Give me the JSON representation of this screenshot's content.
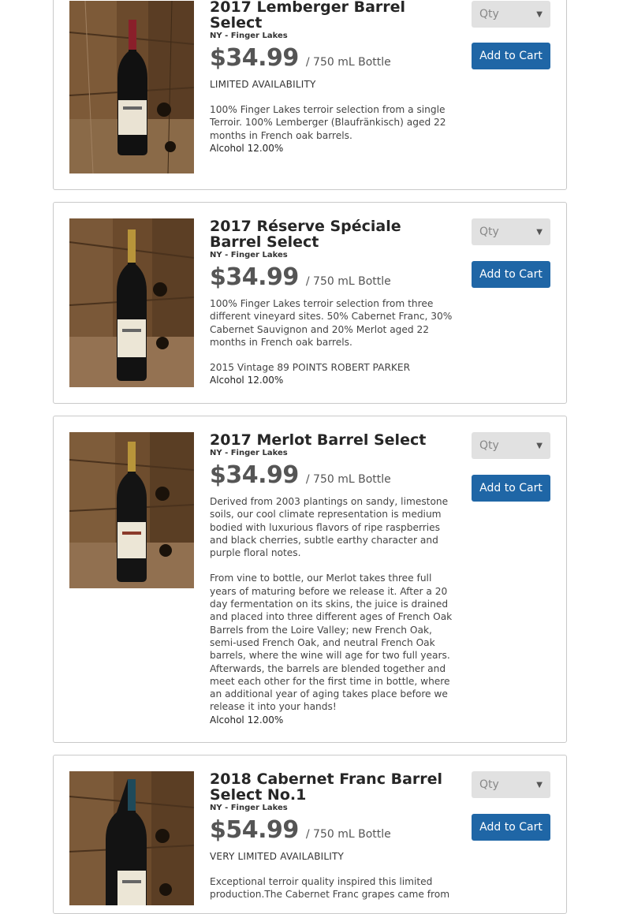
{
  "colors": {
    "button_bg": "#1f66a6",
    "select_bg": "#e1e1e1",
    "price": "#555555",
    "card_border": "#c9c9c9"
  },
  "products": [
    {
      "title": "2017 Lemberger Barrel Select",
      "region": "NY - Finger Lakes",
      "price": "$34.99",
      "unit": "/ 750 mL Bottle",
      "availability": "LIMITED AVAILABILITY",
      "description": [
        "100% Finger Lakes terroir selection from a single Terroir. 100% Lemberger (Blaufränkisch) aged 22 months in French oak barrels."
      ],
      "alcohol": "Alcohol 12.00%",
      "qty_placeholder": "Qty",
      "cart_label": "Add to Cart",
      "capsule_color": "#8a1f2a"
    },
    {
      "title": "2017 Réserve Spéciale Barrel Select",
      "region": "NY - Finger Lakes",
      "price": "$34.99",
      "unit": "/ 750 mL Bottle",
      "availability": "",
      "description": [
        "100% Finger Lakes terroir selection from three different vineyard sites. 50% Cabernet Franc, 30% Cabernet Sauvignon and 20% Merlot aged 22 months in French oak barrels.",
        "2015 Vintage 89 POINTS ROBERT PARKER"
      ],
      "alcohol": "Alcohol 12.00%",
      "qty_placeholder": "Qty",
      "cart_label": "Add to Cart",
      "capsule_color": "#b8953a"
    },
    {
      "title": "2017 Merlot Barrel Select",
      "region": "NY - Finger Lakes",
      "price": "$34.99",
      "unit": "/ 750 mL Bottle",
      "availability": "",
      "description": [
        "Derived from 2003 plantings on sandy, limestone soils, our cool climate representation is medium bodied with luxurious flavors of ripe raspberries and black cherries, subtle earthy character and purple floral notes.",
        "From vine to bottle, our Merlot takes three full years of maturing before we release it. After a 20 day fermentation on its skins, the juice is drained and placed into three different ages of French Oak Barrels from the Loire Valley; new French Oak, semi-used French Oak, and neutral French Oak barrels, where the wine will age for two full years. Afterwards, the barrels are blended together and meet each other for the first time in bottle, where an additional year of aging takes place before we release it into your hands!"
      ],
      "alcohol": "Alcohol 12.00%",
      "qty_placeholder": "Qty",
      "cart_label": "Add to Cart",
      "capsule_color": "#b8953a"
    },
    {
      "title": "2018 Cabernet Franc Barrel Select No.1",
      "region": "NY - Finger Lakes",
      "price": "$54.99",
      "unit": "/ 750 mL Bottle",
      "availability": "VERY LIMITED AVAILABILITY",
      "description": [
        "Exceptional terroir quality inspired this limited production.The Cabernet Franc grapes came from"
      ],
      "alcohol": "",
      "qty_placeholder": "Qty",
      "cart_label": "Add to Cart",
      "capsule_color": "#1f4a5a"
    }
  ]
}
